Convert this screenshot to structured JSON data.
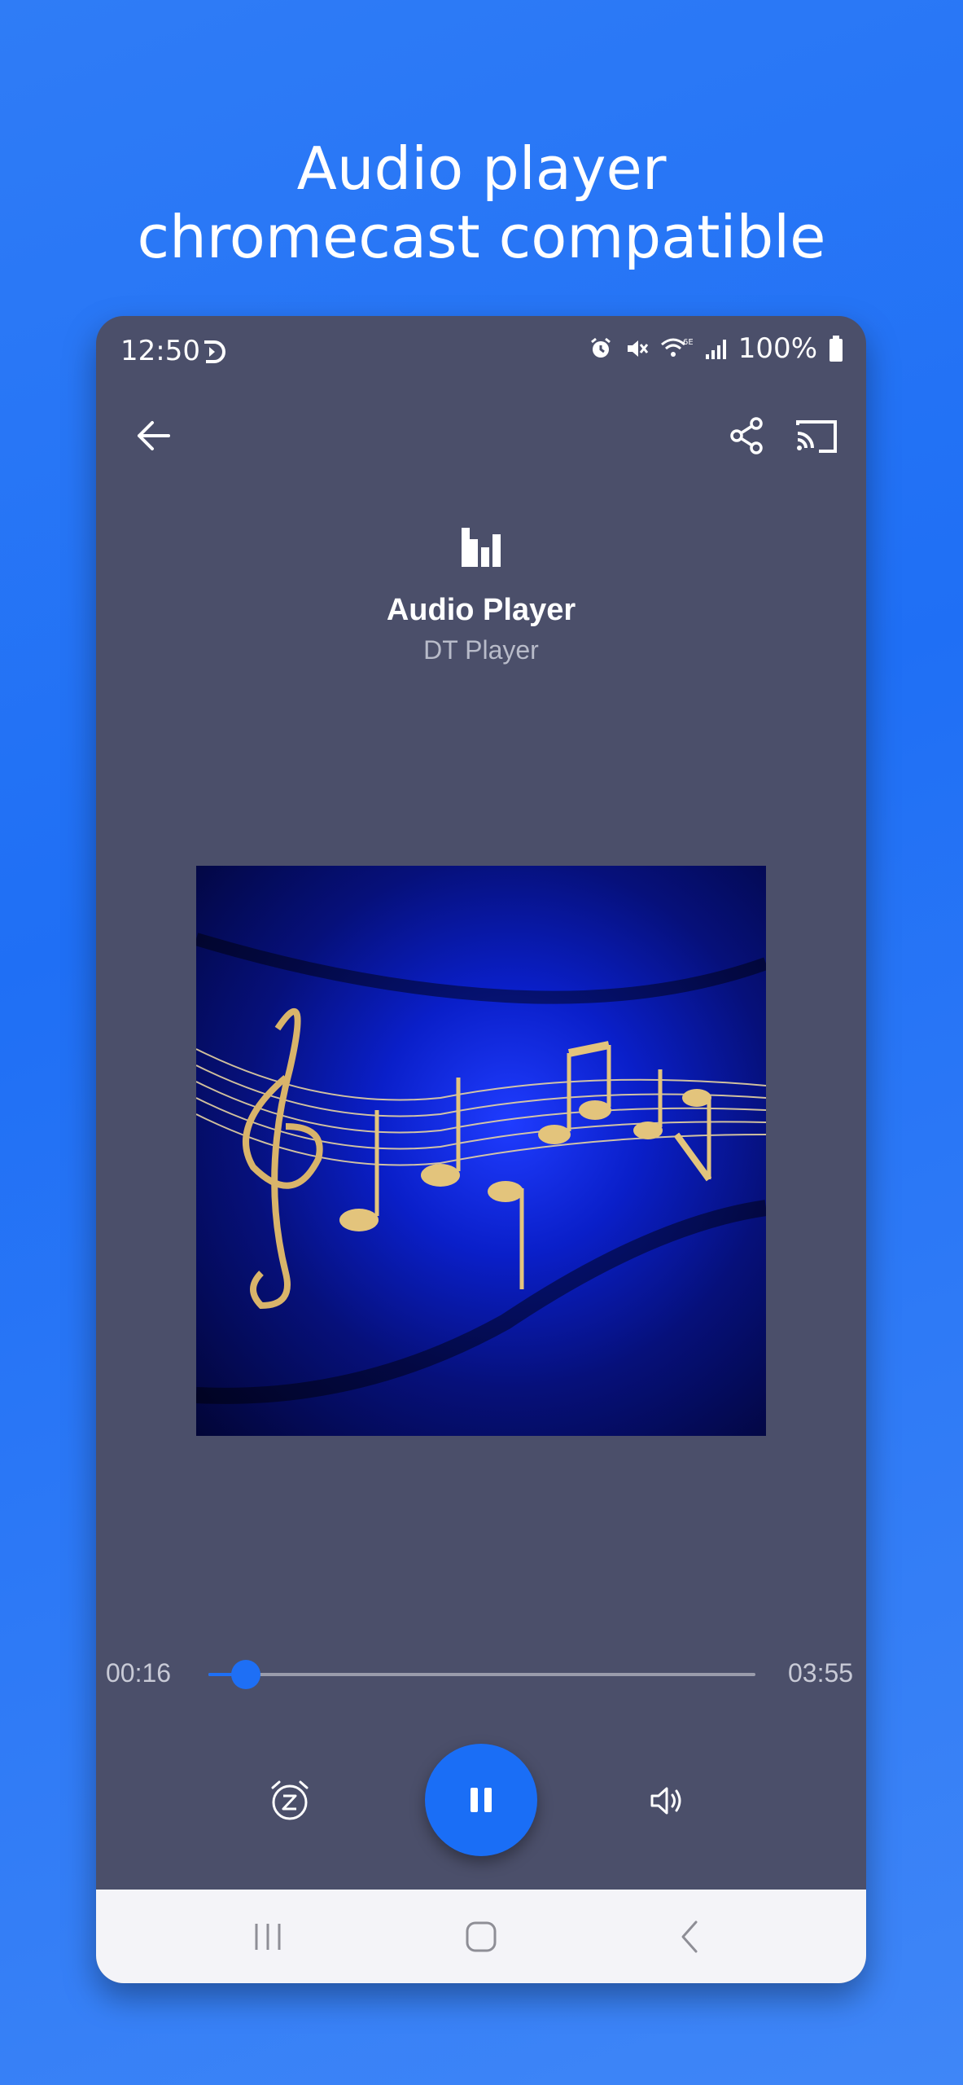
{
  "headline": {
    "line1": "Audio player",
    "line2": "chromecast compatible"
  },
  "status_bar": {
    "time": "12:50",
    "battery": "100%",
    "icons": [
      "sync-icon",
      "alarm-icon",
      "mute-icon",
      "wifi-6e-icon",
      "signal-icon",
      "battery-icon"
    ]
  },
  "toolbar": {
    "icons": [
      "back-arrow-icon",
      "share-icon",
      "cast-icon"
    ]
  },
  "track": {
    "title": "Audio Player",
    "artist": "DT Player"
  },
  "player": {
    "elapsed": "00:16",
    "duration": "03:55",
    "progress": 0.068,
    "state": "playing",
    "controls": [
      "sleep-timer-icon",
      "pause-icon",
      "volume-icon"
    ]
  },
  "nav_bar": {
    "icons": [
      "recent-apps-icon",
      "home-icon",
      "back-icon"
    ]
  },
  "colors": {
    "background": "#2f7cf6",
    "phone_bg": "#4b4f6a",
    "accent": "#1e6ff5",
    "nav_bg": "#f4f4f8"
  }
}
